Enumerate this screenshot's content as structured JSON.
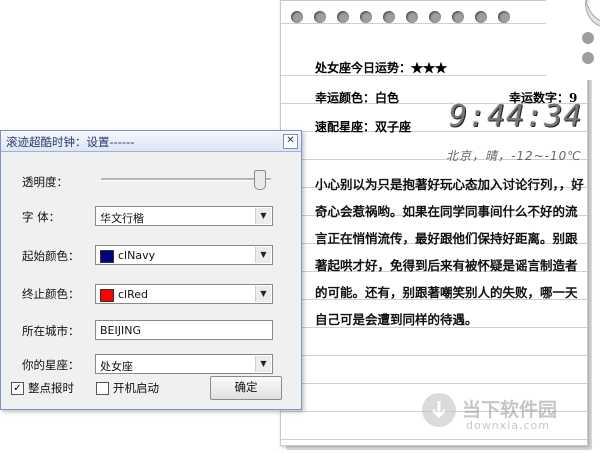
{
  "notepad": {
    "horoscope_title": "处女座今日运势：★★★",
    "lucky_color": "幸运颜色：白色",
    "lucky_number": "幸运数字：9",
    "match_sign": "速配星座：双子座",
    "clock_time": "9:44:34",
    "weather": "北京，晴，-12~-10℃",
    "fortune_text": "小心别以为只是抱著好玩心态加入讨论行列，，好奇心会惹祸哟。如果在同学同事间什么不好的流言正在悄悄流传，最好跟他们保持好距离。别跟著起哄才好，免得到后来有被怀疑是谣言制造者的可能。还有，别跟著嘲笑别人的失败，哪一天自己可是会遭到同样的待遇。"
  },
  "watermark": {
    "name": "当下软件园",
    "url": "downxia.com"
  },
  "dialog": {
    "title": "滚迹超酷时钟：设置------",
    "close_glyph": "✕",
    "transparency_label": "透明度：",
    "transparency_value": 0.97,
    "font_label": "字  体：",
    "font_value": "华文行楷",
    "start_color_label": "起始颜色：",
    "start_color_value": "clNavy",
    "start_color_hex": "#000080",
    "end_color_label": "终止颜色：",
    "end_color_value": "clRed",
    "end_color_hex": "#ff0000",
    "city_label": "所在城市：",
    "city_value": "BEIJING",
    "sign_label": "你的星座：",
    "sign_value": "处女座",
    "hourly_chime_label": "整点报时",
    "hourly_chime_checked": true,
    "autostart_label": "开机启动",
    "autostart_checked": false,
    "ok_label": "确定"
  }
}
